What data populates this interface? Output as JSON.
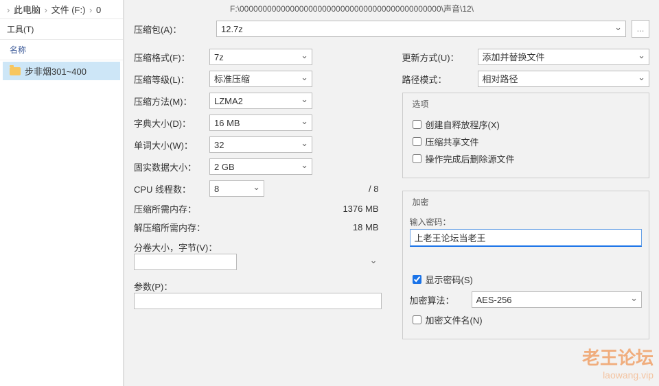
{
  "breadcrumb": {
    "pc": "此电脑",
    "drive": "文件 (F:)",
    "folder": "0"
  },
  "tools_menu": "工具(T)",
  "name_header": "名称",
  "folder_item": "步非烟301~400",
  "archive": {
    "label": "压缩包(A)：",
    "path_above": "F:\\00000000000000000000000000000000000000000000\\声音\\12\\",
    "value": "12.7z",
    "browse": "..."
  },
  "left": {
    "format": {
      "label": "压缩格式(F)：",
      "value": "7z"
    },
    "level": {
      "label": "压缩等级(L)：",
      "value": "标准压缩"
    },
    "method": {
      "label": "压缩方法(M)：",
      "value": "LZMA2"
    },
    "dict": {
      "label": "字典大小(D)：",
      "value": "16 MB"
    },
    "word": {
      "label": "单词大小(W)：",
      "value": "32"
    },
    "solid": {
      "label": "固实数据大小：",
      "value": "2 GB"
    },
    "threads": {
      "label": "CPU 线程数：",
      "value": "8",
      "of": "/ 8"
    },
    "mem_comp": {
      "label": "压缩所需内存：",
      "value": "1376 MB"
    },
    "mem_decomp": {
      "label": "解压缩所需内存：",
      "value": "18 MB"
    },
    "split": {
      "label": "分卷大小，字节(V)：",
      "value": ""
    },
    "params": {
      "label": "参数(P)：",
      "value": ""
    }
  },
  "right": {
    "update": {
      "label": "更新方式(U)：",
      "value": "添加并替换文件"
    },
    "pathmode": {
      "label": "路径模式：",
      "value": "相对路径"
    },
    "options_legend": "选项",
    "opt_sfx": "创建自释放程序(X)",
    "opt_share": "压缩共享文件",
    "opt_delete": "操作完成后删除源文件",
    "enc_legend": "加密",
    "pw_label": "输入密码：",
    "pw_value": "上老王论坛当老王",
    "show_pw": "显示密码(S)",
    "enc_method": {
      "label": "加密算法：",
      "value": "AES-256"
    },
    "enc_names": "加密文件名(N)"
  },
  "watermark": {
    "line1": "老王论坛",
    "line2": "laowang.vip"
  }
}
